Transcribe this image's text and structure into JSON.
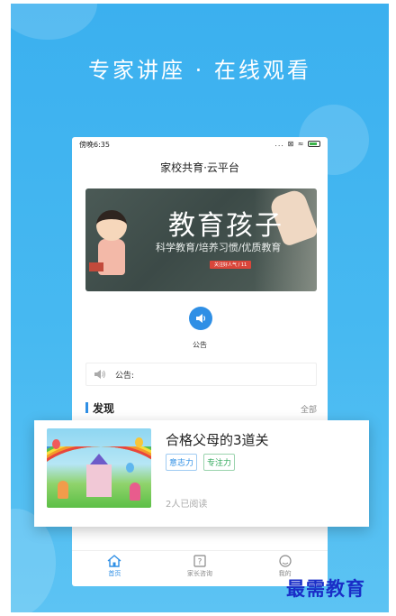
{
  "promo": {
    "headline": "专家讲座  ·  在线观看"
  },
  "statusbar": {
    "time": "傍晚6:35",
    "icons": "... ⊠ ≈"
  },
  "app": {
    "title": "家校共育·云平台"
  },
  "banner": {
    "title": "教育孩子",
    "subtitle": "科学教育/培养习惯/优质教育",
    "tag": "关注好人气 / 11"
  },
  "notice": {
    "label": "公告",
    "announce_prefix": "公告:",
    "announce_text": ""
  },
  "discover": {
    "title": "发现",
    "all_label": "全部"
  },
  "article": {
    "title": "合格父母的3道关",
    "tags": [
      "意志力",
      "专注力"
    ],
    "reads": "2人已阅读"
  },
  "tabbar": {
    "items": [
      {
        "label": "首页",
        "icon": "home-icon",
        "active": true
      },
      {
        "label": "家长咨询",
        "icon": "question-icon",
        "active": false
      },
      {
        "label": "我的",
        "icon": "user-icon",
        "active": false
      }
    ]
  },
  "watermark": "最需教育",
  "colors": {
    "accent": "#2f8fe5",
    "background": "#47b9f1",
    "tag_green": "#2fa85a"
  }
}
